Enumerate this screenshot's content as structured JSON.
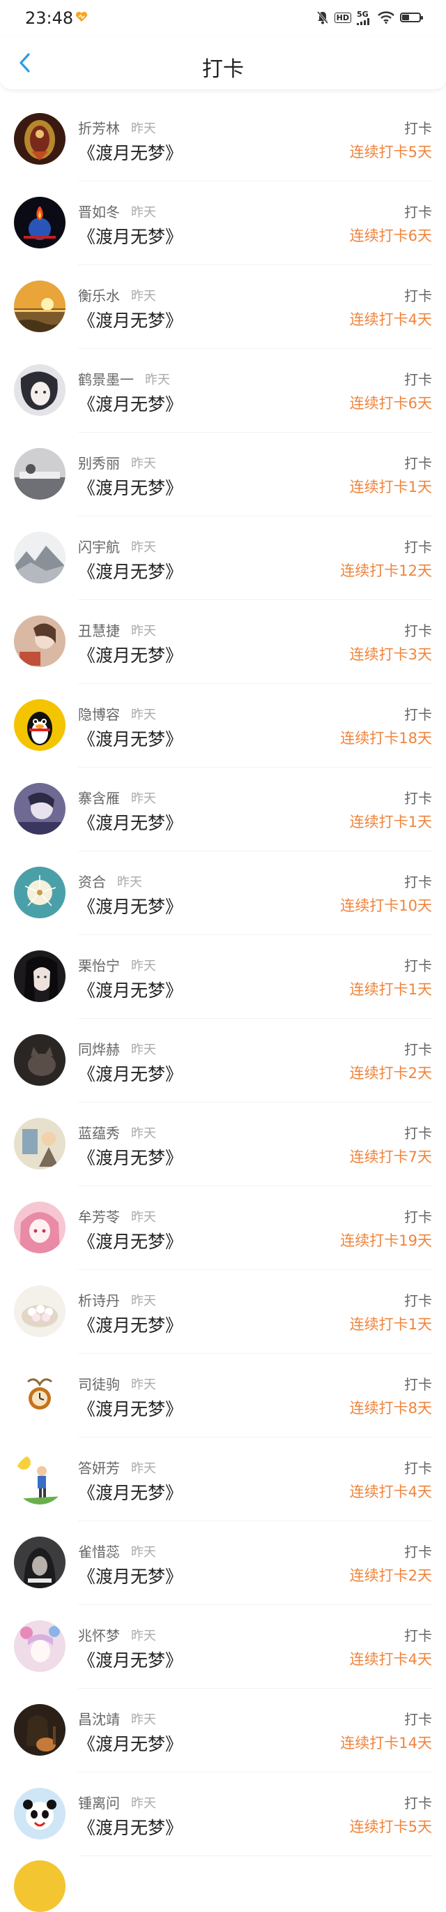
{
  "status_bar": {
    "time": "23:48",
    "network": "5G"
  },
  "header": {
    "title": "打卡"
  },
  "entries": [
    {
      "name": "折芳林",
      "time": "昨天",
      "book": "《渡月无梦》",
      "action": "打卡",
      "streak": "连续打卡5天",
      "avatar": "ornament"
    },
    {
      "name": "晋如冬",
      "time": "昨天",
      "book": "《渡月无梦》",
      "action": "打卡",
      "streak": "连续打卡6天",
      "avatar": "night-fire"
    },
    {
      "name": "衡乐水",
      "time": "昨天",
      "book": "《渡月无梦》",
      "action": "打卡",
      "streak": "连续打卡4天",
      "avatar": "sunset-sea"
    },
    {
      "name": "鹤景墨一",
      "time": "昨天",
      "book": "《渡月无梦》",
      "action": "打卡",
      "streak": "连续打卡6天",
      "avatar": "anime-sketch"
    },
    {
      "name": "别秀丽",
      "time": "昨天",
      "book": "《渡月无梦》",
      "action": "打卡",
      "streak": "连续打卡1天",
      "avatar": "gray-scene"
    },
    {
      "name": "闪宇航",
      "time": "昨天",
      "book": "《渡月无梦》",
      "action": "打卡",
      "streak": "连续打卡12天",
      "avatar": "ink-landscape"
    },
    {
      "name": "丑慧捷",
      "time": "昨天",
      "book": "《渡月无梦》",
      "action": "打卡",
      "streak": "连续打卡3天",
      "avatar": "portrait-warm"
    },
    {
      "name": "隐博容",
      "time": "昨天",
      "book": "《渡月无梦》",
      "action": "打卡",
      "streak": "连续打卡18天",
      "avatar": "penguin"
    },
    {
      "name": "寨含雁",
      "time": "昨天",
      "book": "《渡月无梦》",
      "action": "打卡",
      "streak": "连续打卡1天",
      "avatar": "anime-purple"
    },
    {
      "name": "资合",
      "time": "昨天",
      "book": "《渡月无梦》",
      "action": "打卡",
      "streak": "连续打卡10天",
      "avatar": "dandelion"
    },
    {
      "name": "栗怡宁",
      "time": "昨天",
      "book": "《渡月无梦》",
      "action": "打卡",
      "streak": "连续打卡1天",
      "avatar": "girl-dark"
    },
    {
      "name": "同烨赫",
      "time": "昨天",
      "book": "《渡月无梦》",
      "action": "打卡",
      "streak": "连续打卡2天",
      "avatar": "dark-cat"
    },
    {
      "name": "蓝蕴秀",
      "time": "昨天",
      "book": "《渡月无梦》",
      "action": "打卡",
      "streak": "连续打卡7天",
      "avatar": "sketch-scene"
    },
    {
      "name": "牟芳苓",
      "time": "昨天",
      "book": "《渡月无梦》",
      "action": "打卡",
      "streak": "连续打卡19天",
      "avatar": "pink-anime"
    },
    {
      "name": "析诗丹",
      "time": "昨天",
      "book": "《渡月无梦》",
      "action": "打卡",
      "streak": "连续打卡1天",
      "avatar": "dessert"
    },
    {
      "name": "司徒驹",
      "time": "昨天",
      "book": "《渡月无梦》",
      "action": "打卡",
      "streak": "连续打卡8天",
      "avatar": "clock"
    },
    {
      "name": "答妍芳",
      "time": "昨天",
      "book": "《渡月无梦》",
      "action": "打卡",
      "streak": "连续打卡4天",
      "avatar": "kids-cartoon"
    },
    {
      "name": "雀惜蕊",
      "time": "昨天",
      "book": "《渡月无梦》",
      "action": "打卡",
      "streak": "连续打卡2天",
      "avatar": "hood-dark"
    },
    {
      "name": "兆怀梦",
      "time": "昨天",
      "book": "《渡月无梦》",
      "action": "打卡",
      "streak": "连续打卡4天",
      "avatar": "floral-anime"
    },
    {
      "name": "昌沈靖",
      "time": "昨天",
      "book": "《渡月无梦》",
      "action": "打卡",
      "streak": "连续打卡14天",
      "avatar": "guitar-girl"
    },
    {
      "name": "锺离问",
      "time": "昨天",
      "book": "《渡月无梦》",
      "action": "打卡",
      "streak": "连续打卡5天",
      "avatar": "panda"
    }
  ]
}
